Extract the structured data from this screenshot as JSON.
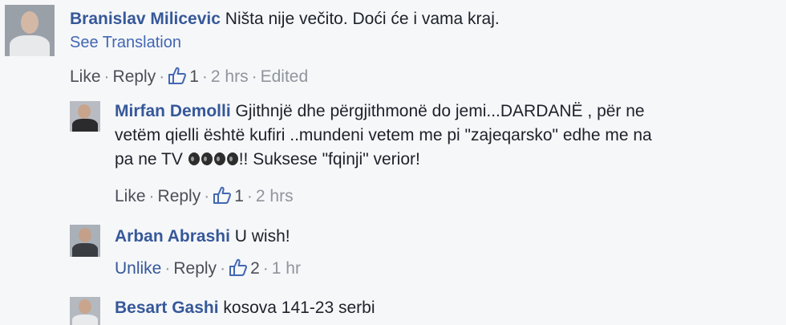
{
  "comments": [
    {
      "author": "Branislav Milicevic",
      "text": "Ništa nije večito. Doći će i vama kraj.",
      "see_translation": "See Translation",
      "actions": {
        "like": "Like",
        "reply": "Reply",
        "likes": "1",
        "time": "2 hrs",
        "edited": "Edited"
      }
    },
    {
      "author": "Mirfan Demolli",
      "text_line1": "Gjithnjë dhe përgjithmonë do jemi...DARDANË , për ne",
      "text_line2": "vetëm qielli është kufiri ..mundeni vetem me pi \"zajeqarsko\" edhe me na",
      "text_line3a": "pa ne TV ",
      "text_line3b": "!! Suksese \"fqinji\" verior!",
      "actions": {
        "like": "Like",
        "reply": "Reply",
        "likes": "1",
        "time": "2 hrs"
      }
    },
    {
      "author": "Arban Abrashi",
      "text": "U wish!",
      "actions": {
        "like": "Unlike",
        "reply": "Reply",
        "likes": "2",
        "time": "1 hr"
      }
    },
    {
      "author": "Besart Gashi",
      "text": "kosova 141-23 serbi"
    }
  ],
  "separator": "·",
  "icons": {
    "thumb": "thumbs-up-icon",
    "emoji": "hands-over-face-emoji-icon"
  },
  "colors": {
    "name": "#365899",
    "meta": "#90949c",
    "link": "#4b4f56",
    "bg": "#f6f7f9"
  }
}
